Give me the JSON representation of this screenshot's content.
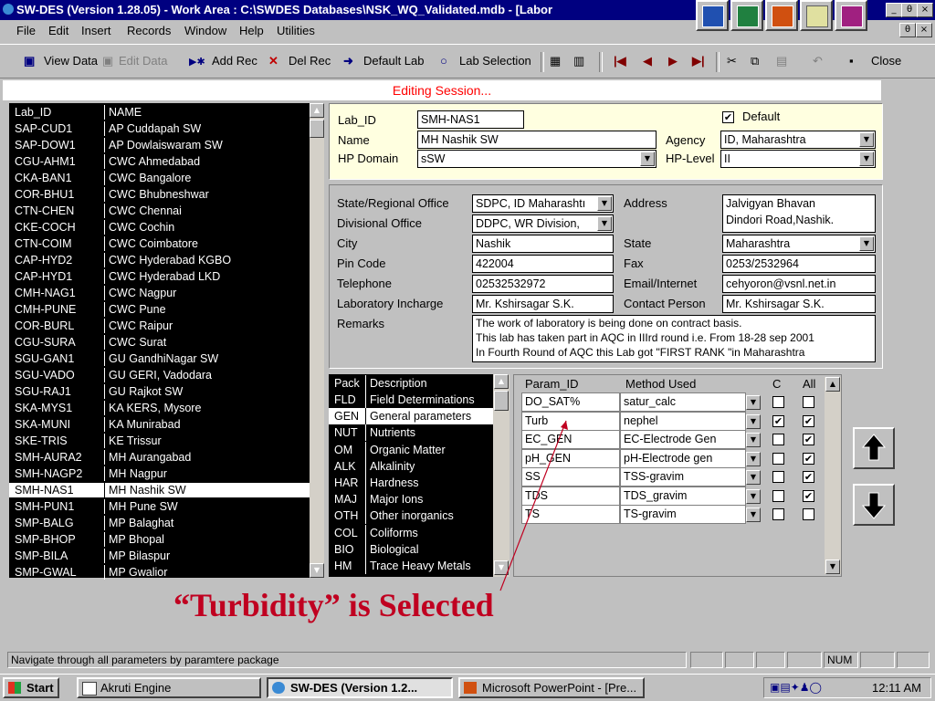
{
  "window": {
    "title": "SW-DES (Version 1.28.05) - Work Area : C:\\SWDES Databases\\NSK_WQ_Validated.mdb - [Labor",
    "inner_controls": [
      "θ",
      "×"
    ],
    "controls": [
      "_",
      "θ",
      "×"
    ]
  },
  "menu": [
    "File",
    "Edit",
    "Insert",
    "Records",
    "Window",
    "Help",
    "Utilities"
  ],
  "toolbar": {
    "view_data": "View Data",
    "edit_data": "Edit Data",
    "add_rec": "Add Rec",
    "del_rec": "Del Rec",
    "default_lab": "Default Lab",
    "lab_selection": "Lab Selection",
    "close": "Close"
  },
  "editing_session": "Editing Session...",
  "lab_list": {
    "headers": [
      "Lab_ID",
      "NAME"
    ],
    "rows": [
      [
        "SAP-CUD1",
        "AP Cuddapah SW"
      ],
      [
        "SAP-DOW1",
        "AP Dowlaiswaram SW"
      ],
      [
        "CGU-AHM1",
        "CWC Ahmedabad"
      ],
      [
        "CKA-BAN1",
        "CWC Bangalore"
      ],
      [
        "COR-BHU1",
        "CWC Bhubneshwar"
      ],
      [
        "CTN-CHEN",
        "CWC Chennai"
      ],
      [
        "CKE-COCH",
        "CWC Cochin"
      ],
      [
        "CTN-COIM",
        "CWC Coimbatore"
      ],
      [
        "CAP-HYD2",
        "CWC Hyderabad KGBO"
      ],
      [
        "CAP-HYD1",
        "CWC Hyderabad LKD"
      ],
      [
        "CMH-NAG1",
        "CWC Nagpur"
      ],
      [
        "CMH-PUNE",
        "CWC Pune"
      ],
      [
        "COR-BURL",
        "CWC Raipur"
      ],
      [
        "CGU-SURA",
        "CWC Surat"
      ],
      [
        "SGU-GAN1",
        "GU GandhiNagar SW"
      ],
      [
        "SGU-VADO",
        "GU GERI, Vadodara"
      ],
      [
        "SGU-RAJ1",
        "GU Rajkot SW"
      ],
      [
        "SKA-MYS1",
        "KA KERS, Mysore"
      ],
      [
        "SKA-MUNI",
        "KA Munirabad"
      ],
      [
        "SKE-TRIS",
        "KE Trissur"
      ],
      [
        "SMH-AURA2",
        "MH Aurangabad"
      ],
      [
        "SMH-NAGP2",
        "MH Nagpur"
      ],
      [
        "SMH-NAS1",
        "MH Nashik SW"
      ],
      [
        "SMH-PUN1",
        "MH Pune SW"
      ],
      [
        "SMP-BALG",
        "MP Balaghat"
      ],
      [
        "SMP-BHOP",
        "MP Bhopal"
      ],
      [
        "SMP-BILA",
        "MP Bilaspur"
      ],
      [
        "SMP-GWAL",
        "MP Gwalior"
      ]
    ],
    "selected_index": 22
  },
  "lab_header": {
    "lab_id_label": "Lab_ID",
    "lab_id": "SMH-NAS1",
    "default_label": "Default",
    "default_checked": "✔",
    "name_label": "Name",
    "name": "MH Nashik SW",
    "agency_label": "Agency",
    "agency": "ID, Maharashtra",
    "hp_domain_label": "HP Domain",
    "hp_domain": "sSW",
    "hp_level_label": "HP-Level",
    "hp_level": "II"
  },
  "details": {
    "state_office_label": "State/Regional Office",
    "state_office": "SDPC, ID Maharashtı",
    "divisional_office_label": "Divisional Office",
    "divisional_office": "DDPC, WR Division,",
    "city_label": "City",
    "city": "Nashik",
    "pin_label": "Pin Code",
    "pin": "422004",
    "telephone_label": "Telephone",
    "telephone": "02532532972",
    "incharge_label": "Laboratory Incharge",
    "incharge": "Mr. Kshirsagar S.K.",
    "remarks_label": "Remarks",
    "remarks": [
      "The work of laboratory is being done on contract basis.",
      "This lab has taken part in AQC in IIIrd round i.e. From 18-28 sep 2001",
      "In Fourth Round of AQC this Lab got \"FIRST RANK \"in Maharashtra"
    ],
    "address_label": "Address",
    "address": [
      "Jalvigyan Bhavan",
      "Dindori Road,Nashik."
    ],
    "state_label": "State",
    "state": "Maharashtra",
    "fax_label": "Fax",
    "fax": "0253/2532964",
    "email_label": "Email/Internet",
    "email": "cehyoron@vsnl.net.in",
    "contact_label": "Contact Person",
    "contact": "Mr. Kshirsagar S.K."
  },
  "packages": {
    "headers": [
      "Pack",
      "Description"
    ],
    "rows": [
      [
        "FLD",
        "Field Determinations"
      ],
      [
        "GEN",
        "General parameters"
      ],
      [
        "NUT",
        "Nutrients"
      ],
      [
        "OM",
        "Organic Matter"
      ],
      [
        "ALK",
        "Alkalinity"
      ],
      [
        "HAR",
        "Hardness"
      ],
      [
        "MAJ",
        "Major Ions"
      ],
      [
        "OTH",
        "Other inorganics"
      ],
      [
        "COL",
        "Coliforms"
      ],
      [
        "BIO",
        "Biological"
      ],
      [
        "HM",
        "Trace Heavy Metals"
      ]
    ],
    "selected_index": 1
  },
  "params": {
    "headers": [
      "Param_ID",
      "Method Used",
      "C",
      "All"
    ],
    "rows": [
      {
        "id": "DO_SAT%",
        "method": "satur_calc",
        "c": "",
        "all": ""
      },
      {
        "id": "Turb",
        "method": "nephel",
        "c": "✔",
        "all": "✔"
      },
      {
        "id": "EC_GEN",
        "method": "EC-Electrode Gen",
        "c": "",
        "all": "✔"
      },
      {
        "id": "pH_GEN",
        "method": "pH-Electrode gen",
        "c": "",
        "all": "✔"
      },
      {
        "id": "SS",
        "method": "TSS-gravim",
        "c": "",
        "all": "✔"
      },
      {
        "id": "TDS",
        "method": "TDS_gravim",
        "c": "",
        "all": "✔"
      },
      {
        "id": "TS",
        "method": "TS-gravim",
        "c": "",
        "all": ""
      }
    ]
  },
  "annotation": "“Turbidity” is Selected",
  "status": {
    "message": "Navigate through all parameters by paramtere package",
    "num": "NUM"
  },
  "taskbar": {
    "start": "Start",
    "tasks": [
      "Akruti Engine",
      "SW-DES (Version 1.2...",
      "Microsoft PowerPoint - [Pre..."
    ],
    "clock": "12:11 AM"
  }
}
